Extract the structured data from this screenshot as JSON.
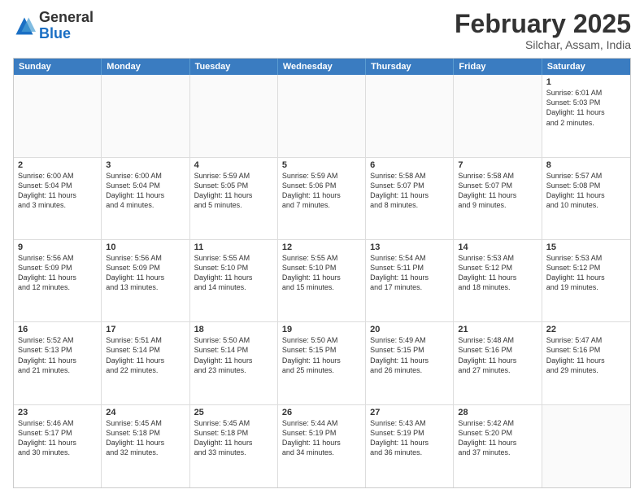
{
  "header": {
    "logo_general": "General",
    "logo_blue": "Blue",
    "month_title": "February 2025",
    "location": "Silchar, Assam, India"
  },
  "calendar": {
    "days_of_week": [
      "Sunday",
      "Monday",
      "Tuesday",
      "Wednesday",
      "Thursday",
      "Friday",
      "Saturday"
    ],
    "weeks": [
      [
        {
          "day": "",
          "info": ""
        },
        {
          "day": "",
          "info": ""
        },
        {
          "day": "",
          "info": ""
        },
        {
          "day": "",
          "info": ""
        },
        {
          "day": "",
          "info": ""
        },
        {
          "day": "",
          "info": ""
        },
        {
          "day": "1",
          "info": "Sunrise: 6:01 AM\nSunset: 5:03 PM\nDaylight: 11 hours\nand 2 minutes."
        }
      ],
      [
        {
          "day": "2",
          "info": "Sunrise: 6:00 AM\nSunset: 5:04 PM\nDaylight: 11 hours\nand 3 minutes."
        },
        {
          "day": "3",
          "info": "Sunrise: 6:00 AM\nSunset: 5:04 PM\nDaylight: 11 hours\nand 4 minutes."
        },
        {
          "day": "4",
          "info": "Sunrise: 5:59 AM\nSunset: 5:05 PM\nDaylight: 11 hours\nand 5 minutes."
        },
        {
          "day": "5",
          "info": "Sunrise: 5:59 AM\nSunset: 5:06 PM\nDaylight: 11 hours\nand 7 minutes."
        },
        {
          "day": "6",
          "info": "Sunrise: 5:58 AM\nSunset: 5:07 PM\nDaylight: 11 hours\nand 8 minutes."
        },
        {
          "day": "7",
          "info": "Sunrise: 5:58 AM\nSunset: 5:07 PM\nDaylight: 11 hours\nand 9 minutes."
        },
        {
          "day": "8",
          "info": "Sunrise: 5:57 AM\nSunset: 5:08 PM\nDaylight: 11 hours\nand 10 minutes."
        }
      ],
      [
        {
          "day": "9",
          "info": "Sunrise: 5:56 AM\nSunset: 5:09 PM\nDaylight: 11 hours\nand 12 minutes."
        },
        {
          "day": "10",
          "info": "Sunrise: 5:56 AM\nSunset: 5:09 PM\nDaylight: 11 hours\nand 13 minutes."
        },
        {
          "day": "11",
          "info": "Sunrise: 5:55 AM\nSunset: 5:10 PM\nDaylight: 11 hours\nand 14 minutes."
        },
        {
          "day": "12",
          "info": "Sunrise: 5:55 AM\nSunset: 5:10 PM\nDaylight: 11 hours\nand 15 minutes."
        },
        {
          "day": "13",
          "info": "Sunrise: 5:54 AM\nSunset: 5:11 PM\nDaylight: 11 hours\nand 17 minutes."
        },
        {
          "day": "14",
          "info": "Sunrise: 5:53 AM\nSunset: 5:12 PM\nDaylight: 11 hours\nand 18 minutes."
        },
        {
          "day": "15",
          "info": "Sunrise: 5:53 AM\nSunset: 5:12 PM\nDaylight: 11 hours\nand 19 minutes."
        }
      ],
      [
        {
          "day": "16",
          "info": "Sunrise: 5:52 AM\nSunset: 5:13 PM\nDaylight: 11 hours\nand 21 minutes."
        },
        {
          "day": "17",
          "info": "Sunrise: 5:51 AM\nSunset: 5:14 PM\nDaylight: 11 hours\nand 22 minutes."
        },
        {
          "day": "18",
          "info": "Sunrise: 5:50 AM\nSunset: 5:14 PM\nDaylight: 11 hours\nand 23 minutes."
        },
        {
          "day": "19",
          "info": "Sunrise: 5:50 AM\nSunset: 5:15 PM\nDaylight: 11 hours\nand 25 minutes."
        },
        {
          "day": "20",
          "info": "Sunrise: 5:49 AM\nSunset: 5:15 PM\nDaylight: 11 hours\nand 26 minutes."
        },
        {
          "day": "21",
          "info": "Sunrise: 5:48 AM\nSunset: 5:16 PM\nDaylight: 11 hours\nand 27 minutes."
        },
        {
          "day": "22",
          "info": "Sunrise: 5:47 AM\nSunset: 5:16 PM\nDaylight: 11 hours\nand 29 minutes."
        }
      ],
      [
        {
          "day": "23",
          "info": "Sunrise: 5:46 AM\nSunset: 5:17 PM\nDaylight: 11 hours\nand 30 minutes."
        },
        {
          "day": "24",
          "info": "Sunrise: 5:45 AM\nSunset: 5:18 PM\nDaylight: 11 hours\nand 32 minutes."
        },
        {
          "day": "25",
          "info": "Sunrise: 5:45 AM\nSunset: 5:18 PM\nDaylight: 11 hours\nand 33 minutes."
        },
        {
          "day": "26",
          "info": "Sunrise: 5:44 AM\nSunset: 5:19 PM\nDaylight: 11 hours\nand 34 minutes."
        },
        {
          "day": "27",
          "info": "Sunrise: 5:43 AM\nSunset: 5:19 PM\nDaylight: 11 hours\nand 36 minutes."
        },
        {
          "day": "28",
          "info": "Sunrise: 5:42 AM\nSunset: 5:20 PM\nDaylight: 11 hours\nand 37 minutes."
        },
        {
          "day": "",
          "info": ""
        }
      ]
    ]
  }
}
